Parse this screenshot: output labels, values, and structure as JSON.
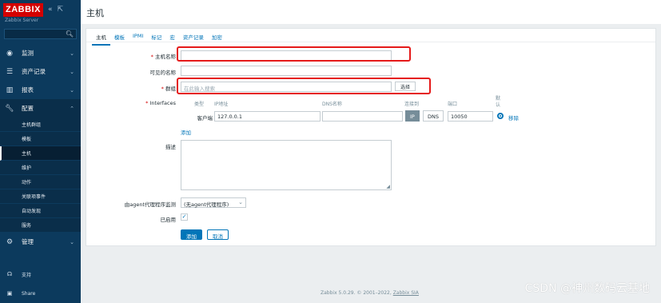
{
  "app": {
    "logo": "ZABBIX",
    "server_name": "Zabbix Server",
    "collapse_icon": "double-chevron-left",
    "kiosk_icon": "expand-icon"
  },
  "sidebar": {
    "items": [
      {
        "label": "监测",
        "icon": "eye-icon"
      },
      {
        "label": "资产记录",
        "icon": "list-icon"
      },
      {
        "label": "报表",
        "icon": "bar-chart-icon"
      },
      {
        "label": "配置",
        "icon": "wrench-icon"
      }
    ],
    "config_sub": [
      "主机群组",
      "模板",
      "主机",
      "维护",
      "动作",
      "关联项事件",
      "自动发现",
      "服务"
    ],
    "admin": {
      "label": "管理",
      "icon": "gear-icon"
    },
    "support": "支持",
    "share": "Share"
  },
  "header": {
    "title": "主机"
  },
  "tabs": [
    "主机",
    "模板",
    "IPMI",
    "标记",
    "宏",
    "资产记录",
    "加密"
  ],
  "form": {
    "hostname_label": "主机名称",
    "visible_name_label": "可见的名称",
    "groups_label": "群组",
    "groups_placeholder": "在此输入搜索",
    "select_button": "选择",
    "interfaces_label": "Interfaces",
    "iface_headers": {
      "type": "类型",
      "ip": "IP地址",
      "dns": "DNS名称",
      "connect": "连接到",
      "port": "端口",
      "default": "默认"
    },
    "iface_row": {
      "type": "客户端",
      "ip": "127.0.0.1",
      "dns": "",
      "ip_btn": "IP",
      "dns_btn": "DNS",
      "port": "10050",
      "remove": "移除"
    },
    "add_link": "添加",
    "description_label": "描述",
    "proxy_label": "由agent代理程序监测",
    "proxy_value": "(无agent代理程序)",
    "enabled_label": "已启用",
    "add_button": "添加",
    "cancel_button": "取消"
  },
  "footer": {
    "copyright": "Zabbix 5.0.29. © 2001–2022, ",
    "company": "Zabbix SIA"
  },
  "watermark": "CSDN @神州数码云基地",
  "colors": {
    "sidebar": "#0c3a5d",
    "accent": "#0275b8",
    "highlight": "#e51a1a",
    "logo": "#d40000"
  }
}
